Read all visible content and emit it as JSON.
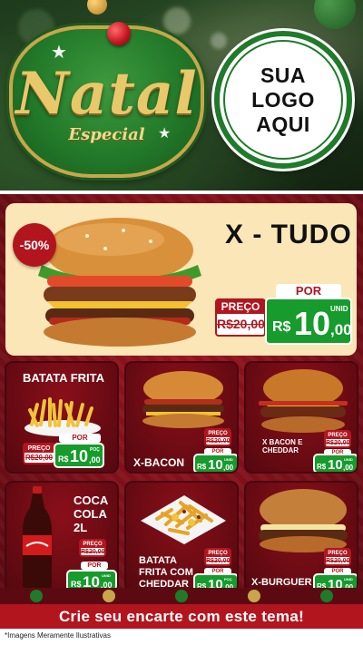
{
  "header": {
    "title": "Natal",
    "subtitle": "Especial",
    "logo_lines": [
      "SUA",
      "LOGO",
      "AQUI"
    ]
  },
  "featured": {
    "name": "X - TUDO",
    "discount": "-50%",
    "old_label": "PREÇO",
    "old_price": "R$20,00",
    "por_label": "POR",
    "currency": "R$",
    "price_int": "10",
    "price_dec": ",00",
    "unit": "UNID"
  },
  "products": [
    {
      "name": "BATATA FRITA",
      "old_label": "PREÇO",
      "old_price": "R$20,00",
      "por_label": "POR",
      "currency": "R$",
      "price_int": "10",
      "price_dec": ",00",
      "unit": "POÇ"
    },
    {
      "name": "X-BACON",
      "old_label": "PREÇO",
      "old_price": "R$20,00",
      "por_label": "POR",
      "currency": "R$",
      "price_int": "10",
      "price_dec": ",00",
      "unit": "UNID"
    },
    {
      "name": "X BACON E CHEDDAR",
      "old_label": "PREÇO",
      "old_price": "R$20,00",
      "por_label": "POR",
      "currency": "R$",
      "price_int": "10",
      "price_dec": ",00",
      "unit": "UNID"
    },
    {
      "name": "COCA COLA 2L",
      "old_label": "PREÇO",
      "old_price": "R$20,00",
      "por_label": "POR",
      "currency": "R$",
      "price_int": "10",
      "price_dec": ",00",
      "unit": "UNID"
    },
    {
      "name": "BATATA FRITA COM CHEDDAR",
      "old_label": "PREÇO",
      "old_price": "R$20,00",
      "por_label": "POR",
      "currency": "R$",
      "price_int": "10",
      "price_dec": ",00",
      "unit": "POÇ"
    },
    {
      "name": "X-BURGUER",
      "old_label": "PREÇO",
      "old_price": "R$20,00",
      "por_label": "POR",
      "currency": "R$",
      "price_int": "10",
      "price_dec": ",00",
      "unit": "UNID"
    }
  ],
  "cta": "Crie seu encarte com este tema!",
  "disclaimer": "*Imagens Meramente Ilustrativas",
  "colors": {
    "accent_red": "#b3151e",
    "price_green": "#169b2c",
    "featured_bg": "#fbe6b8",
    "gold": "#e8c86a"
  },
  "icons": [
    "burger-image",
    "fries-image",
    "soda-bottle-image",
    "christmas-ornament-icon",
    "star-icon"
  ]
}
